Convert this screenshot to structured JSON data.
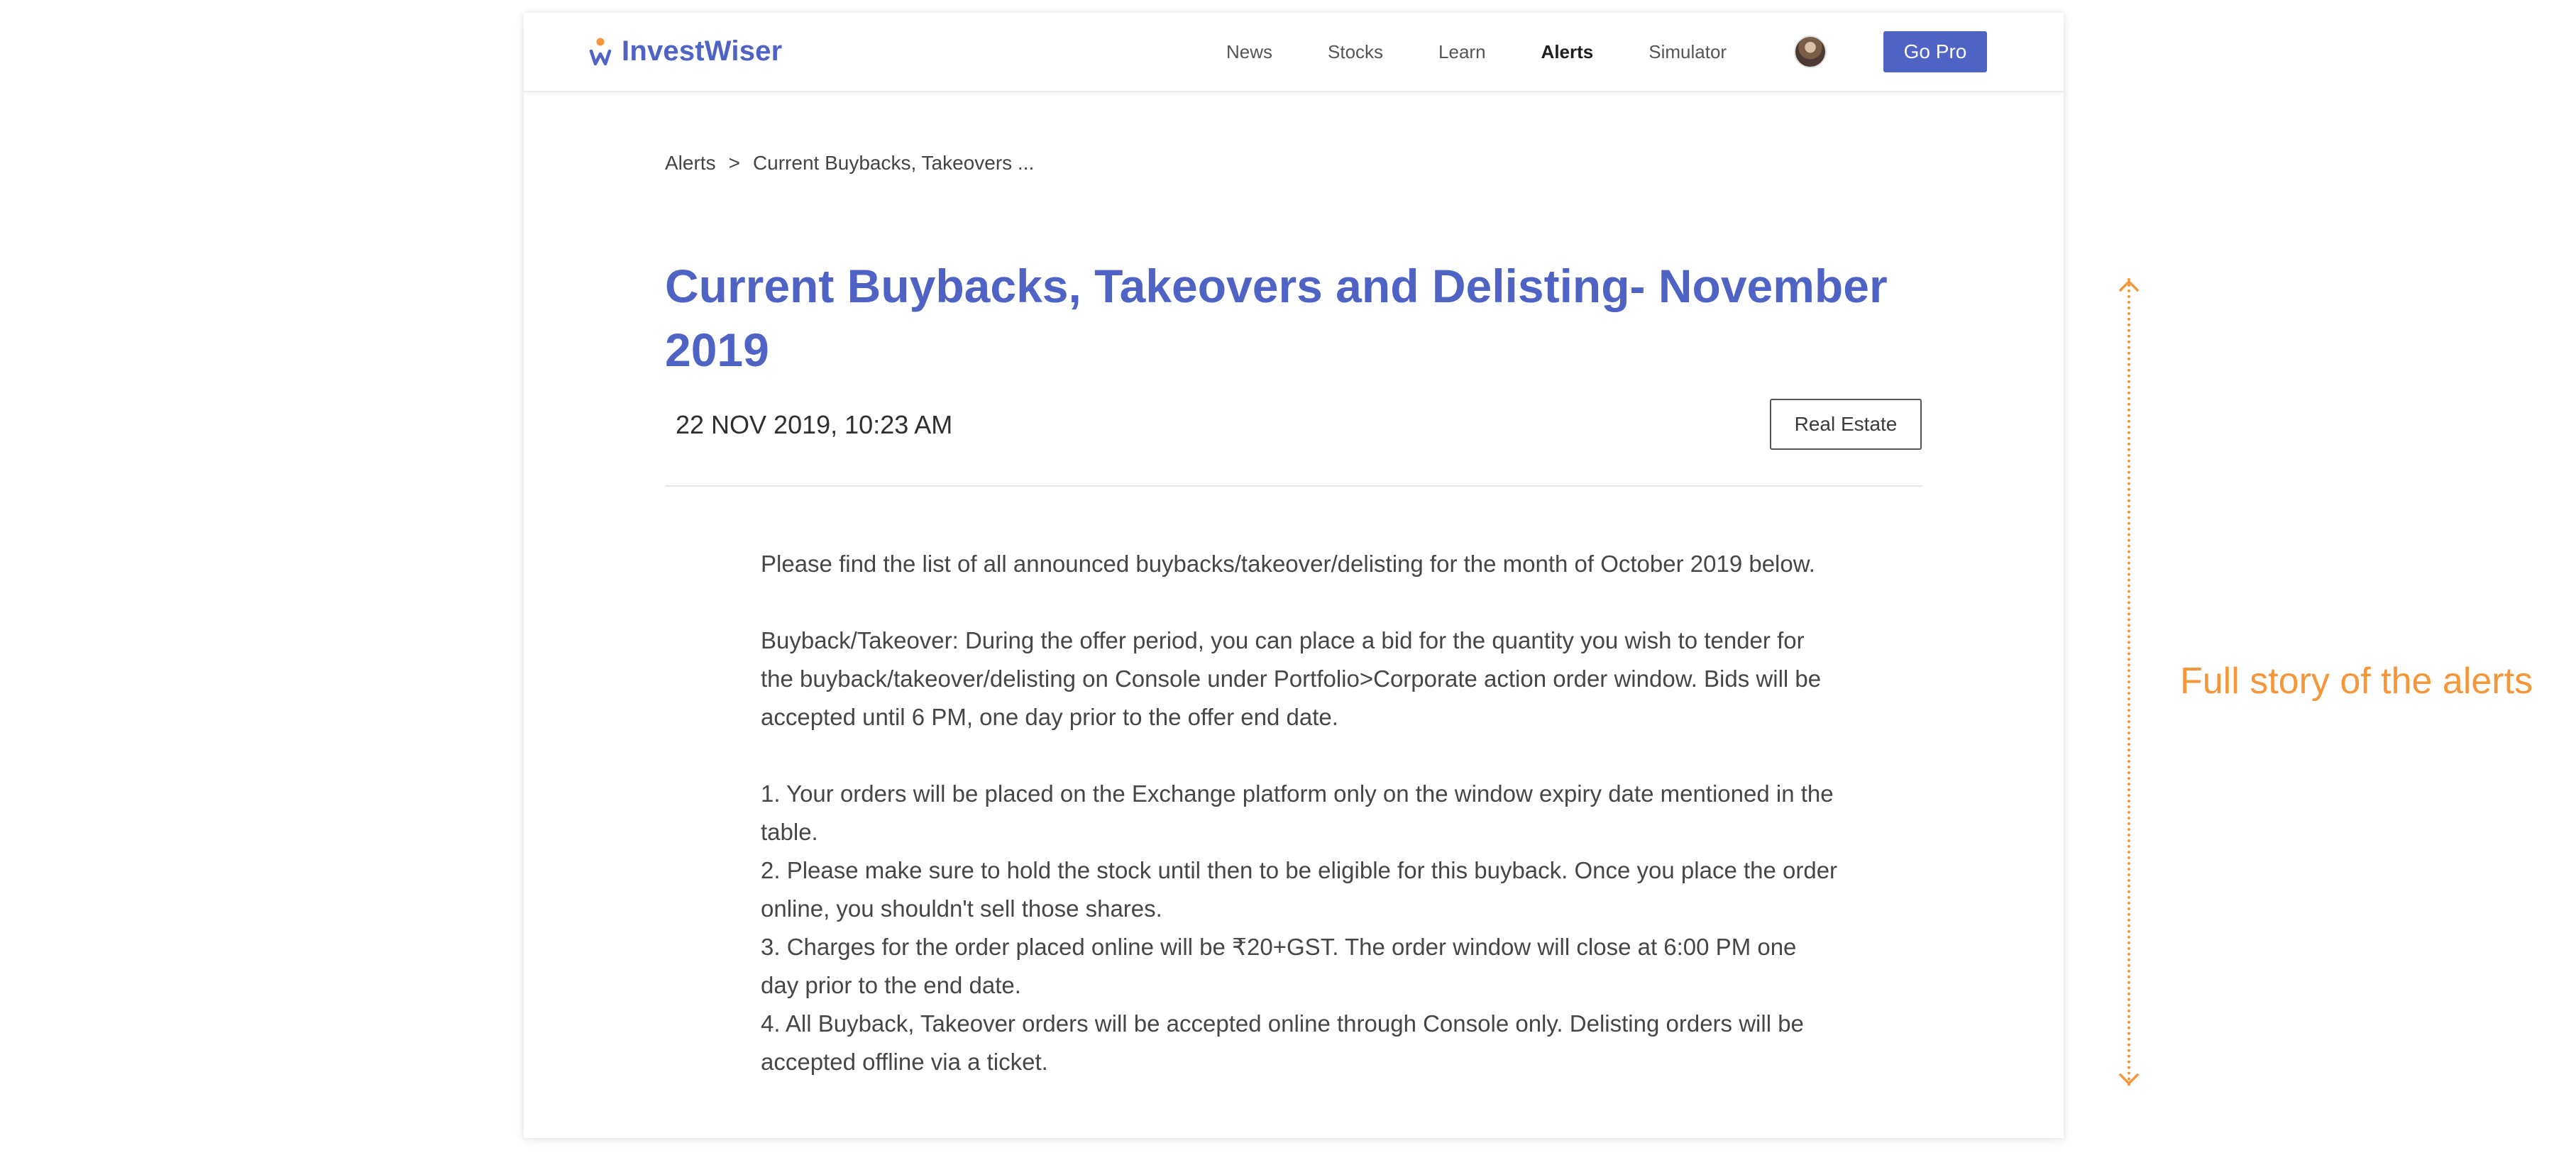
{
  "brand": {
    "name": "InvestWiser",
    "accent_color": "#4e63c3",
    "logo_icon": "investwiser-logo-icon"
  },
  "nav": {
    "items": [
      {
        "label": "News"
      },
      {
        "label": "Stocks"
      },
      {
        "label": "Learn"
      },
      {
        "label": "Alerts",
        "active": true
      },
      {
        "label": "Simulator"
      }
    ],
    "avatar_icon": "user-avatar",
    "cta_label": "Go Pro"
  },
  "breadcrumb": {
    "root": "Alerts",
    "separator": ">",
    "current": "Current Buybacks, Takeovers ..."
  },
  "article": {
    "title": "Current Buybacks, Takeovers and Delisting- November 2019",
    "date": "22 NOV 2019, 10:23 AM",
    "tag": "Real Estate",
    "intro": "Please find the list of all announced buybacks/takeover/delisting for the month of October 2019 below.",
    "buyback_note": "Buyback/Takeover: During the offer period, you can place a bid for the quantity you wish to tender for the buyback/takeover/delisting on Console under Portfolio>Corporate action order window. Bids will be accepted until 6 PM, one day prior to the offer end date.",
    "points": [
      "1. Your orders will be placed on the Exchange platform only on the window expiry date mentioned in the table.",
      "2. Please make sure to hold the stock until then to be eligible for this buyback. Once you place the order online, you shouldn't sell those shares.",
      "3. Charges for the order placed online will be ₹20+GST. The order window will close at 6:00 PM one day prior to the end date.",
      "4. All Buyback, Takeover orders will be accepted online through Console only. Delisting orders will be accepted offline via a ticket."
    ]
  },
  "annotation": {
    "label": "Full story of the alerts",
    "color": "#f5963a"
  }
}
